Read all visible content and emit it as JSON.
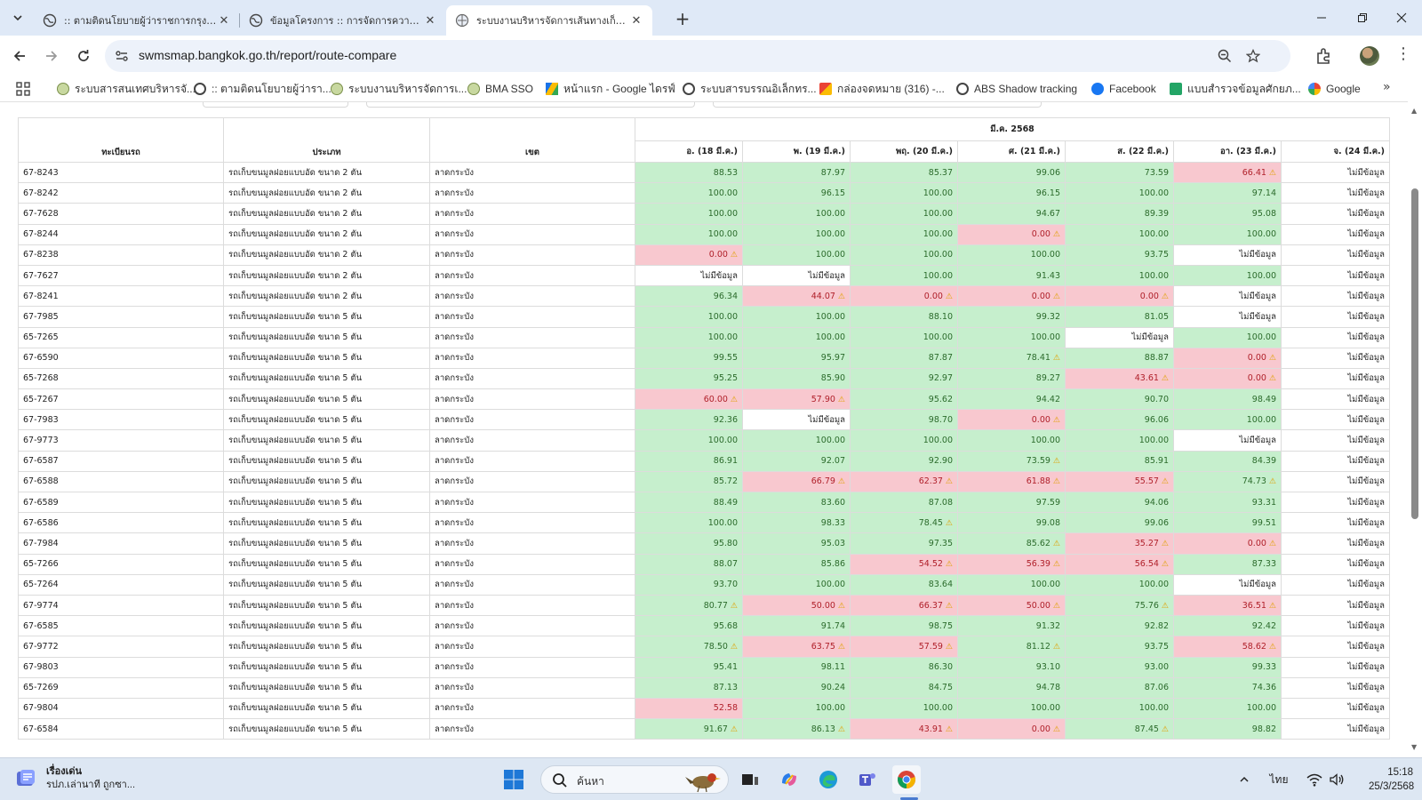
{
  "browser": {
    "tabs": [
      {
        "label": ":: ตามติดนโยบายผู้ว่าราชการกรุงเทพ",
        "active": false
      },
      {
        "label": "ข้อมูลโครงการ :: การจัดการความครอ",
        "active": false
      },
      {
        "label": "ระบบงานบริหารจัดการเส้นทางเก็บขน",
        "active": true
      }
    ],
    "url": "swmsmap.bangkok.go.th/report/route-compare",
    "bookmarks": [
      "ระบบสารสนเทศบริหารจั...",
      ":: ตามติดนโยบายผู้ว่ารา...",
      "ระบบงานบริหารจัดการเ...",
      "BMA SSO",
      "หน้าแรก - Google ไดรฟ์",
      "ระบบสารบรรณอิเล็กทร...",
      "กล่องจดหมาย (316) -...",
      "ABS Shadow tracking",
      "Facebook",
      "แบบสำรวจข้อมูลศักยภ...",
      "Google"
    ]
  },
  "table": {
    "headers": {
      "plate": "ทะเบียนรถ",
      "type": "ประเภท",
      "district": "เขต",
      "month": "มี.ค. 2568"
    },
    "days": [
      "อ. (18 มี.ค.)",
      "พ. (19 มี.ค.)",
      "พฤ. (20 มี.ค.)",
      "ศ. (21 มี.ค.)",
      "ส. (22 มี.ค.)",
      "อา. (23 มี.ค.)",
      "จ. (24 มี.ค.)"
    ],
    "no_data_text": "ไม่มีข้อมูล",
    "rows": [
      {
        "plate": "67-8243",
        "type": "รถเก็บขนมูลฝอยแบบอัด ขนาด 2 ตัน",
        "district": "ลาดกระบัง",
        "values": [
          "88.53",
          "87.97",
          "85.37",
          "99.06",
          "73.59",
          "66.41",
          null
        ],
        "status": [
          "g",
          "g",
          "g",
          "g",
          "g",
          "bw",
          "n"
        ]
      },
      {
        "plate": "67-8242",
        "type": "รถเก็บขนมูลฝอยแบบอัด ขนาด 2 ตัน",
        "district": "ลาดกระบัง",
        "values": [
          "100.00",
          "96.15",
          "100.00",
          "96.15",
          "100.00",
          "97.14",
          null
        ],
        "status": [
          "g",
          "g",
          "g",
          "g",
          "g",
          "g",
          "n"
        ]
      },
      {
        "plate": "67-7628",
        "type": "รถเก็บขนมูลฝอยแบบอัด ขนาด 2 ตัน",
        "district": "ลาดกระบัง",
        "values": [
          "100.00",
          "100.00",
          "100.00",
          "94.67",
          "89.39",
          "95.08",
          null
        ],
        "status": [
          "g",
          "g",
          "g",
          "g",
          "g",
          "g",
          "n"
        ]
      },
      {
        "plate": "67-8244",
        "type": "รถเก็บขนมูลฝอยแบบอัด ขนาด 2 ตัน",
        "district": "ลาดกระบัง",
        "values": [
          "100.00",
          "100.00",
          "100.00",
          "0.00",
          "100.00",
          "100.00",
          null
        ],
        "status": [
          "g",
          "g",
          "g",
          "bw",
          "g",
          "g",
          "n"
        ]
      },
      {
        "plate": "67-8238",
        "type": "รถเก็บขนมูลฝอยแบบอัด ขนาด 2 ตัน",
        "district": "ลาดกระบัง",
        "values": [
          "0.00",
          "100.00",
          "100.00",
          "100.00",
          "93.75",
          null,
          null
        ],
        "status": [
          "bw",
          "g",
          "g",
          "g",
          "g",
          "n",
          "n"
        ]
      },
      {
        "plate": "67-7627",
        "type": "รถเก็บขนมูลฝอยแบบอัด ขนาด 2 ตัน",
        "district": "ลาดกระบัง",
        "values": [
          null,
          null,
          "100.00",
          "91.43",
          "100.00",
          "100.00",
          null
        ],
        "status": [
          "n",
          "n",
          "g",
          "g",
          "g",
          "g",
          "n"
        ]
      },
      {
        "plate": "67-8241",
        "type": "รถเก็บขนมูลฝอยแบบอัด ขนาด 2 ตัน",
        "district": "ลาดกระบัง",
        "values": [
          "96.34",
          "44.07",
          "0.00",
          "0.00",
          "0.00",
          null,
          null
        ],
        "status": [
          "g",
          "bw",
          "bw",
          "bw",
          "bw",
          "n",
          "n"
        ]
      },
      {
        "plate": "67-7985",
        "type": "รถเก็บขนมูลฝอยแบบอัด ขนาด 5 ตัน",
        "district": "ลาดกระบัง",
        "values": [
          "100.00",
          "100.00",
          "88.10",
          "99.32",
          "81.05",
          null,
          null
        ],
        "status": [
          "g",
          "g",
          "g",
          "g",
          "g",
          "n",
          "n"
        ]
      },
      {
        "plate": "65-7265",
        "type": "รถเก็บขนมูลฝอยแบบอัด ขนาด 5 ตัน",
        "district": "ลาดกระบัง",
        "values": [
          "100.00",
          "100.00",
          "100.00",
          "100.00",
          null,
          "100.00",
          null
        ],
        "status": [
          "g",
          "g",
          "g",
          "g",
          "n",
          "g",
          "n"
        ]
      },
      {
        "plate": "67-6590",
        "type": "รถเก็บขนมูลฝอยแบบอัด ขนาด 5 ตัน",
        "district": "ลาดกระบัง",
        "values": [
          "99.55",
          "95.97",
          "87.87",
          "78.41",
          "88.87",
          "0.00",
          null
        ],
        "status": [
          "g",
          "g",
          "g",
          "gw",
          "g",
          "bw",
          "n"
        ]
      },
      {
        "plate": "65-7268",
        "type": "รถเก็บขนมูลฝอยแบบอัด ขนาด 5 ตัน",
        "district": "ลาดกระบัง",
        "values": [
          "95.25",
          "85.90",
          "92.97",
          "89.27",
          "43.61",
          "0.00",
          null
        ],
        "status": [
          "g",
          "g",
          "g",
          "g",
          "bw",
          "bw",
          "n"
        ]
      },
      {
        "plate": "65-7267",
        "type": "รถเก็บขนมูลฝอยแบบอัด ขนาด 5 ตัน",
        "district": "ลาดกระบัง",
        "values": [
          "60.00",
          "57.90",
          "95.62",
          "94.42",
          "90.70",
          "98.49",
          null
        ],
        "status": [
          "bw",
          "bw",
          "g",
          "g",
          "g",
          "g",
          "n"
        ]
      },
      {
        "plate": "67-7983",
        "type": "รถเก็บขนมูลฝอยแบบอัด ขนาด 5 ตัน",
        "district": "ลาดกระบัง",
        "values": [
          "92.36",
          null,
          "98.70",
          "0.00",
          "96.06",
          "100.00",
          null
        ],
        "status": [
          "g",
          "n",
          "g",
          "bw",
          "g",
          "g",
          "n"
        ]
      },
      {
        "plate": "67-9773",
        "type": "รถเก็บขนมูลฝอยแบบอัด ขนาด 5 ตัน",
        "district": "ลาดกระบัง",
        "values": [
          "100.00",
          "100.00",
          "100.00",
          "100.00",
          "100.00",
          null,
          null
        ],
        "status": [
          "g",
          "g",
          "g",
          "g",
          "g",
          "n",
          "n"
        ]
      },
      {
        "plate": "67-6587",
        "type": "รถเก็บขนมูลฝอยแบบอัด ขนาด 5 ตัน",
        "district": "ลาดกระบัง",
        "values": [
          "86.91",
          "92.07",
          "92.90",
          "73.59",
          "85.91",
          "84.39",
          null
        ],
        "status": [
          "g",
          "g",
          "g",
          "gw",
          "g",
          "g",
          "n"
        ]
      },
      {
        "plate": "67-6588",
        "type": "รถเก็บขนมูลฝอยแบบอัด ขนาด 5 ตัน",
        "district": "ลาดกระบัง",
        "values": [
          "85.72",
          "66.79",
          "62.37",
          "61.88",
          "55.57",
          "74.73",
          null
        ],
        "status": [
          "g",
          "bw",
          "bw",
          "bw",
          "bw",
          "gw",
          "n"
        ]
      },
      {
        "plate": "67-6589",
        "type": "รถเก็บขนมูลฝอยแบบอัด ขนาด 5 ตัน",
        "district": "ลาดกระบัง",
        "values": [
          "88.49",
          "83.60",
          "87.08",
          "97.59",
          "94.06",
          "93.31",
          null
        ],
        "status": [
          "g",
          "g",
          "g",
          "g",
          "g",
          "g",
          "n"
        ]
      },
      {
        "plate": "67-6586",
        "type": "รถเก็บขนมูลฝอยแบบอัด ขนาด 5 ตัน",
        "district": "ลาดกระบัง",
        "values": [
          "100.00",
          "98.33",
          "78.45",
          "99.08",
          "99.06",
          "99.51",
          null
        ],
        "status": [
          "g",
          "g",
          "gw",
          "g",
          "g",
          "g",
          "n"
        ]
      },
      {
        "plate": "67-7984",
        "type": "รถเก็บขนมูลฝอยแบบอัด ขนาด 5 ตัน",
        "district": "ลาดกระบัง",
        "values": [
          "95.80",
          "95.03",
          "97.35",
          "85.62",
          "35.27",
          "0.00",
          null
        ],
        "status": [
          "g",
          "g",
          "g",
          "gw",
          "bw",
          "bw",
          "n"
        ]
      },
      {
        "plate": "65-7266",
        "type": "รถเก็บขนมูลฝอยแบบอัด ขนาด 5 ตัน",
        "district": "ลาดกระบัง",
        "values": [
          "88.07",
          "85.86",
          "54.52",
          "56.39",
          "56.54",
          "87.33",
          null
        ],
        "status": [
          "g",
          "g",
          "bw",
          "bw",
          "bw",
          "g",
          "n"
        ]
      },
      {
        "plate": "65-7264",
        "type": "รถเก็บขนมูลฝอยแบบอัด ขนาด 5 ตัน",
        "district": "ลาดกระบัง",
        "values": [
          "93.70",
          "100.00",
          "83.64",
          "100.00",
          "100.00",
          null,
          null
        ],
        "status": [
          "g",
          "g",
          "g",
          "g",
          "g",
          "n",
          "n"
        ]
      },
      {
        "plate": "67-9774",
        "type": "รถเก็บขนมูลฝอยแบบอัด ขนาด 5 ตัน",
        "district": "ลาดกระบัง",
        "values": [
          "80.77",
          "50.00",
          "66.37",
          "50.00",
          "75.76",
          "36.51",
          null
        ],
        "status": [
          "gw",
          "bw",
          "bw",
          "bw",
          "gw",
          "bw",
          "n"
        ]
      },
      {
        "plate": "67-6585",
        "type": "รถเก็บขนมูลฝอยแบบอัด ขนาด 5 ตัน",
        "district": "ลาดกระบัง",
        "values": [
          "95.68",
          "91.74",
          "98.75",
          "91.32",
          "92.82",
          "92.42",
          null
        ],
        "status": [
          "g",
          "g",
          "g",
          "g",
          "g",
          "g",
          "n"
        ]
      },
      {
        "plate": "67-9772",
        "type": "รถเก็บขนมูลฝอยแบบอัด ขนาด 5 ตัน",
        "district": "ลาดกระบัง",
        "values": [
          "78.50",
          "63.75",
          "57.59",
          "81.12",
          "93.75",
          "58.62",
          null
        ],
        "status": [
          "gw",
          "bw",
          "bw",
          "gw",
          "g",
          "bw",
          "n"
        ]
      },
      {
        "plate": "67-9803",
        "type": "รถเก็บขนมูลฝอยแบบอัด ขนาด 5 ตัน",
        "district": "ลาดกระบัง",
        "values": [
          "95.41",
          "98.11",
          "86.30",
          "93.10",
          "93.00",
          "99.33",
          null
        ],
        "status": [
          "g",
          "g",
          "g",
          "g",
          "g",
          "g",
          "n"
        ]
      },
      {
        "plate": "65-7269",
        "type": "รถเก็บขนมูลฝอยแบบอัด ขนาด 5 ตัน",
        "district": "ลาดกระบัง",
        "values": [
          "87.13",
          "90.24",
          "84.75",
          "94.78",
          "87.06",
          "74.36",
          null
        ],
        "status": [
          "g",
          "g",
          "g",
          "g",
          "g",
          "g",
          "n"
        ]
      },
      {
        "plate": "67-9804",
        "type": "รถเก็บขนมูลฝอยแบบอัด ขนาด 5 ตัน",
        "district": "ลาดกระบัง",
        "values": [
          "52.58",
          "100.00",
          "100.00",
          "100.00",
          "100.00",
          "100.00",
          null
        ],
        "status": [
          "b",
          "g",
          "g",
          "g",
          "g",
          "g",
          "n"
        ]
      },
      {
        "plate": "67-6584",
        "type": "รถเก็บขนมูลฝอยแบบอัด ขนาด 5 ตัน",
        "district": "ลาดกระบัง",
        "values": [
          "91.67",
          "86.13",
          "43.91",
          "0.00",
          "87.45",
          "98.82",
          null
        ],
        "status": [
          "gw",
          "gw",
          "bw",
          "bw",
          "gw",
          "g",
          "n"
        ]
      }
    ]
  },
  "colors": {
    "good_bg": "#c6efcd",
    "bad_bg": "#f8c8cf",
    "warning": "#e0a000",
    "accent": "#0b57d0"
  },
  "taskbar": {
    "weather_title": "เรื่องเด่น",
    "weather_sub": "รปภ.เล่านาที ถูกซา...",
    "search_placeholder": "ค้นหา",
    "lang": "ไทย",
    "time": "15:18",
    "date": "25/3/2568"
  }
}
